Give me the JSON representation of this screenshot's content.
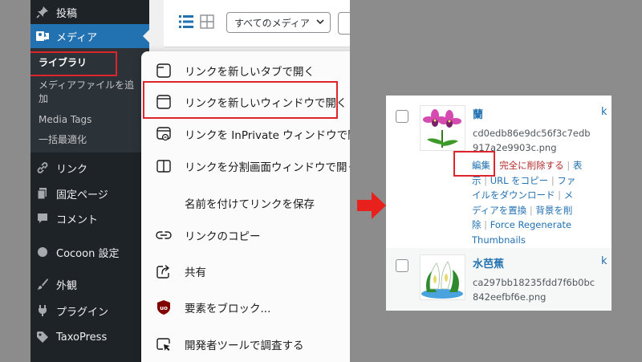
{
  "sidebar": {
    "items": [
      {
        "label": "投稿",
        "icon": "pin-icon"
      },
      {
        "label": "メディア",
        "icon": "media-icon"
      },
      {
        "label": "リンク",
        "icon": "link-icon"
      },
      {
        "label": "固定ページ",
        "icon": "page-icon"
      },
      {
        "label": "コメント",
        "icon": "comment-icon"
      },
      {
        "label": "Cocoon 設定",
        "icon": "circle-icon"
      },
      {
        "label": "外観",
        "icon": "brush-icon"
      },
      {
        "label": "プラグイン",
        "icon": "plugin-icon"
      },
      {
        "label": "TaxoPress",
        "icon": "tag-icon"
      }
    ],
    "submenu": {
      "library": "ライブラリ",
      "add_new_line1": "メディアファイルを追",
      "add_new_line2": "加",
      "media_tags": "Media Tags",
      "optimize": "一括最適化"
    }
  },
  "toolbar": {
    "filter_value": "すべてのメディア"
  },
  "context_menu": {
    "items": [
      {
        "label": "リンクを新しいタブで開く",
        "icon": "new-tab-icon"
      },
      {
        "label": "リンクを新しいウィンドウで開く",
        "icon": "new-window-icon"
      },
      {
        "label": "リンクを InPrivate ウィンドウで開く",
        "icon": "inprivate-icon"
      },
      {
        "label": "リンクを分割画面ウィンドウで開く",
        "icon": "split-screen-icon"
      },
      {
        "label": "名前を付けてリンクを保存",
        "icon": ""
      },
      {
        "label": "リンクのコピー",
        "icon": "link-copy-icon"
      },
      {
        "label": "共有",
        "icon": "share-icon"
      },
      {
        "label": "要素をブロック...",
        "icon": "ublock-icon"
      },
      {
        "label": "開発者ツールで調査する",
        "icon": "devtools-icon"
      }
    ]
  },
  "media_list": {
    "items": [
      {
        "title": "蘭",
        "filename_line1": "cd0edb86e9dc56f3c7edb",
        "filename_line2": "917a2e9903c.png",
        "column_k": "k",
        "actions": {
          "edit": "編集",
          "delete": "完全に削除する",
          "view_line1": "表",
          "view_line2": "示",
          "copy_url": "URL をコピー",
          "download_line1": "ファ",
          "download_line2": "イルをダウンロード",
          "replace_line1": "メ",
          "replace_line2": "ディアを置換",
          "remove_bg_line1": "背景を削",
          "remove_bg_line2": "除",
          "regenerate_line1": "Force Regenerate",
          "regenerate_line2": "Thumbnails"
        }
      },
      {
        "title": "水芭蕉",
        "filename_line1": "ca297bb18235fdd7f6b0bc",
        "filename_line2": "842eefbf6e.png",
        "column_k": "k"
      }
    ]
  },
  "colors": {
    "highlight_box": "#e0242b",
    "arrow": "#e8211c",
    "wp_sidebar": "#1d2327",
    "wp_active": "#2271b1",
    "link_blue": "#2271b1",
    "delete_red": "#b32d2e"
  }
}
